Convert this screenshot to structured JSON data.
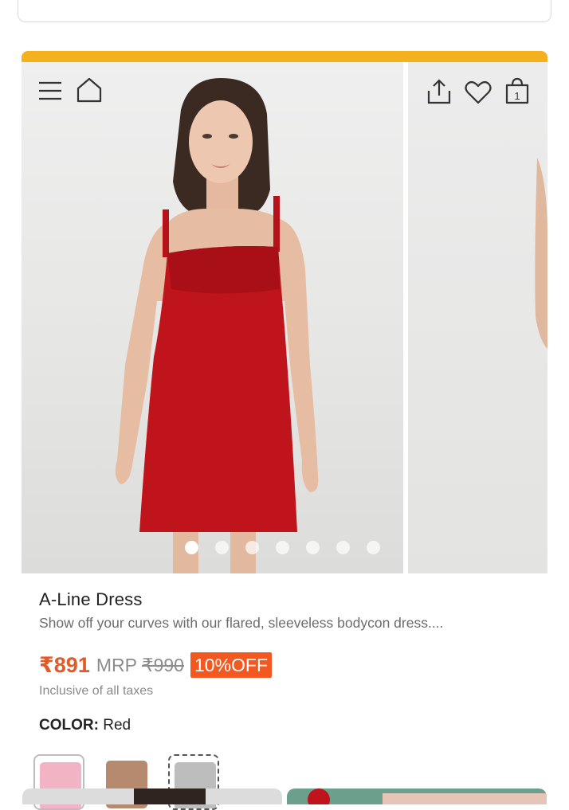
{
  "product": {
    "title": "A-Line Dress",
    "description": "Show off your curves with our flared, sleeveless bodycon dress....",
    "price": "₹891",
    "mrp_label": "MRP",
    "mrp_value": "₹990",
    "discount": "10%OFF",
    "tax_note": "Inclusive of all taxes",
    "color_label": "COLOR:",
    "color_value": "Red"
  },
  "gallery": {
    "image_count": 7,
    "active_index": 0,
    "cart_count": "1"
  },
  "icons": {
    "menu": "hamburger-icon",
    "home": "home-icon",
    "share": "share-icon",
    "wishlist": "heart-icon",
    "cart": "shopping-bag-icon"
  },
  "swatches": [
    {
      "name": "pink",
      "color": "#f2b3c4",
      "selected": true
    },
    {
      "name": "brown",
      "color": "#b58a6e",
      "selected": false
    },
    {
      "name": "grey",
      "color": "#bdbdbd",
      "selected": false
    }
  ],
  "colors": {
    "accent_bar": "#f5b01e",
    "price": "#e25a29",
    "discount_bg": "#f2581f",
    "dress": "#c0141c"
  }
}
